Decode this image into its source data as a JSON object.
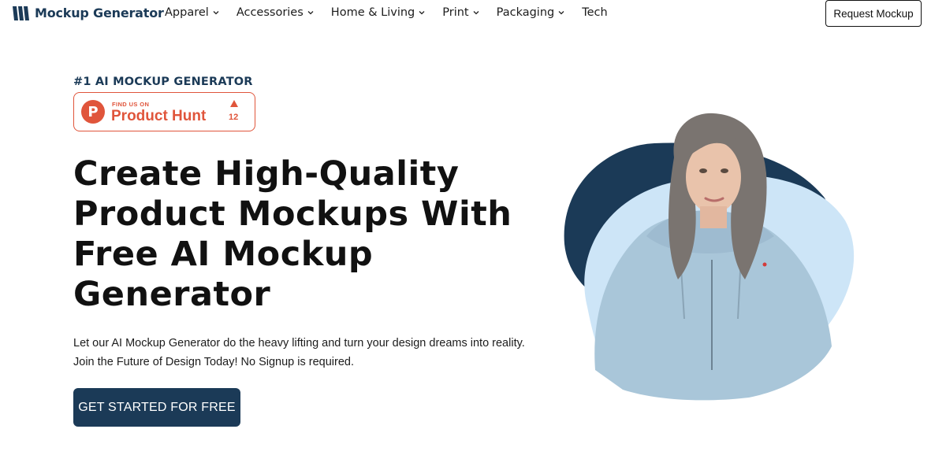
{
  "brand": {
    "name": "Mockup Generator",
    "logo_icon": "stripes-logo-icon",
    "color": "#1b3a57"
  },
  "nav": {
    "items": [
      {
        "label": "Apparel",
        "dropdown": true
      },
      {
        "label": "Accessories",
        "dropdown": true
      },
      {
        "label": "Home & Living",
        "dropdown": true
      },
      {
        "label": "Print",
        "dropdown": true
      },
      {
        "label": "Packaging",
        "dropdown": true
      },
      {
        "label": "Tech",
        "dropdown": false
      }
    ],
    "request_button": "Request Mockup"
  },
  "hero": {
    "tagline": "#1 AI MOCKUP GENERATOR",
    "product_hunt": {
      "letter": "P",
      "find_us": "FIND US ON",
      "name": "Product Hunt",
      "upvotes": "12",
      "color": "#e0553b"
    },
    "headline_lines": [
      "Create High-Quality",
      "Product Mockups With",
      "Free AI Mockup",
      "Generator"
    ],
    "subtext_lines": [
      "Let our AI Mockup Generator do the heavy lifting and turn your design dreams into reality.",
      "Join the Future of Design Today! No Signup is required."
    ],
    "cta": "GET STARTED FOR FREE",
    "image": {
      "subject": "woman-in-light-blue-hoodie",
      "blob_dark": "#1b3a57",
      "blob_light": "#cde5f7"
    }
  }
}
